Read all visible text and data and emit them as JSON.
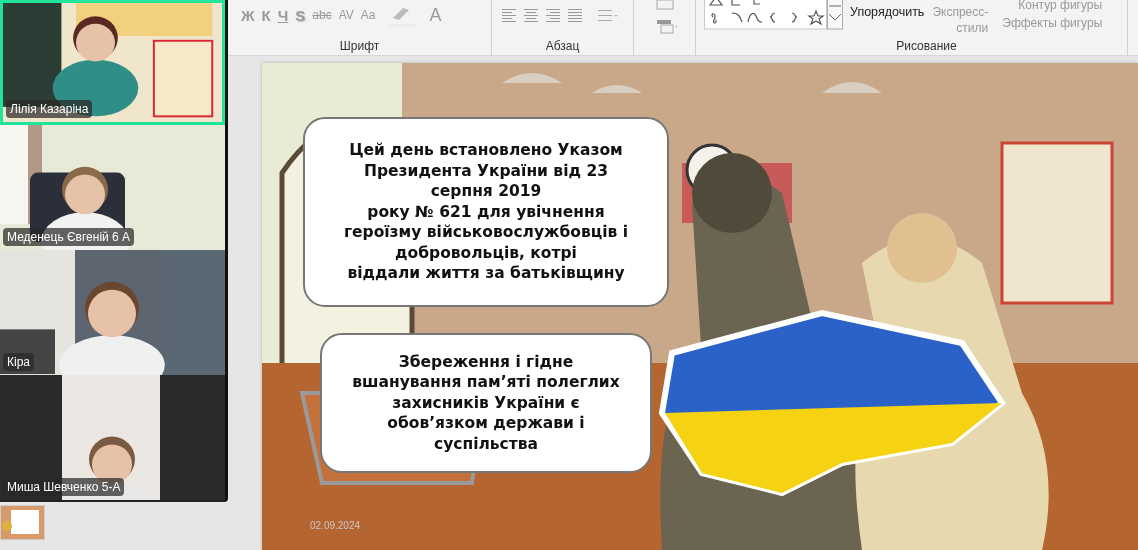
{
  "ribbon": {
    "font_tools": [
      "Ж",
      "К",
      "Ч",
      "S",
      "abc",
      "AV",
      "Aa"
    ],
    "font_color_tool": "A",
    "groups": [
      {
        "label": "Шрифт"
      },
      {
        "label": "Абзац"
      },
      {
        "label": "Рисование"
      }
    ],
    "arrange": "Упорядочить",
    "quick_styles": "Экспресс-\nстили",
    "shape_outline": "Контур фигуры",
    "shape_effects": "Эффекты фигуры"
  },
  "participants": [
    {
      "name": "Лілія Казаріна",
      "speaking": true
    },
    {
      "name": "Меденець Євгеній 6 А",
      "speaking": false
    },
    {
      "name": "Кіра",
      "speaking": false
    },
    {
      "name": "Миша Шевченко 5-А",
      "speaking": false
    }
  ],
  "slide": {
    "callouts": [
      "Цей день встановлено Указом\nПрезидента України від 23\nсерпня 2019\nроку № 621 для увічнення\nгероїзму військовослужбовців і\nдобровольців, котрі\nвіддали життя за батьківщину",
      "Збереження і гідне\nвшанування пам’яті полеглих\nзахисників України є\nобов’язком держави і\nсуспільства"
    ],
    "date": "02.09.2024"
  }
}
